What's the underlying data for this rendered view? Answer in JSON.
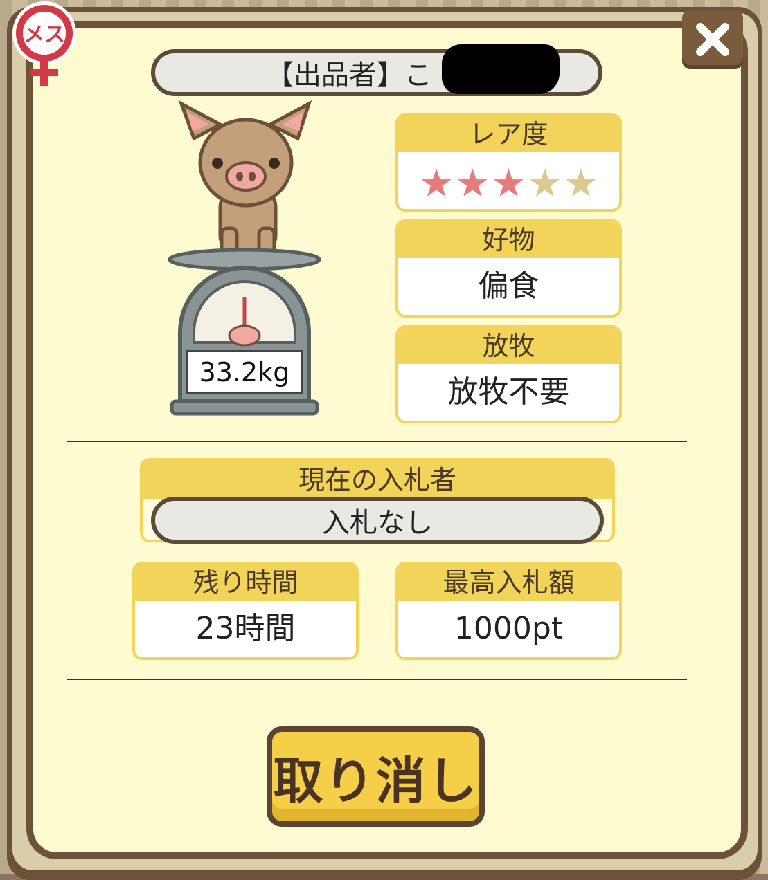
{
  "badge": {
    "label": "メス",
    "color": "#d23a4a"
  },
  "close_button": {
    "icon": "close-icon"
  },
  "seller": {
    "label": "【出品者】こ"
  },
  "pig": {
    "weight": "33.2kg"
  },
  "rarity": {
    "header": "レア度",
    "stars_filled": 3,
    "stars_total": 5,
    "filled_color": "#e67b7b",
    "empty_color": "#dcc98f"
  },
  "favorite": {
    "header": "好物",
    "value": "偏食"
  },
  "pasture": {
    "header": "放牧",
    "value": "放牧不要"
  },
  "current_bidder": {
    "header": "現在の入札者",
    "value": "入札なし"
  },
  "remaining_time": {
    "header": "残り時間",
    "value": "23時間"
  },
  "highest_bid": {
    "header": "最高入札額",
    "value": "1000pt"
  },
  "cancel_button": {
    "label": "取り消し"
  },
  "colors": {
    "panel": "#fffbd0",
    "frame": "#6b5238",
    "accent": "#f3d45a"
  }
}
